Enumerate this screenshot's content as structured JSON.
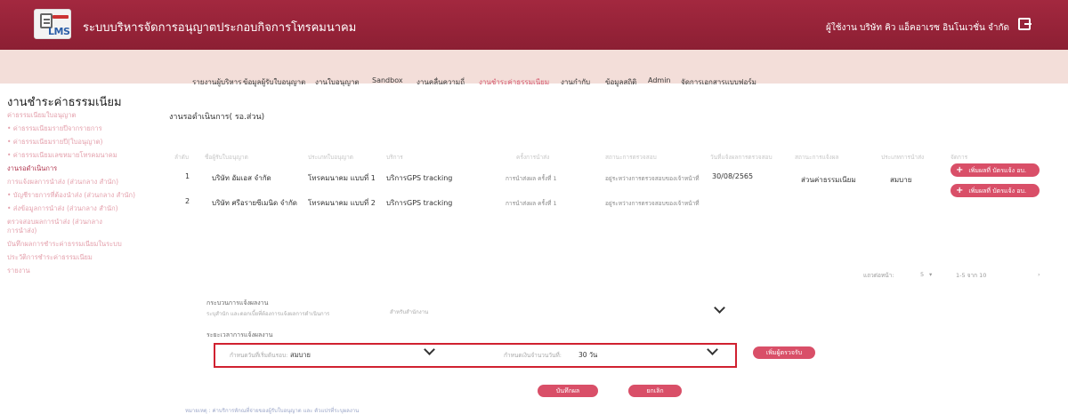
{
  "header": {
    "logo_text": "LMS",
    "title": "ระบบบริหารจัดการอนุญาตประกอบกิจการโทรคมนาคม",
    "user": "ผู้ใช้งาน บริษัท คิว แอ็คอาเรซ อินโนเวชั่น จำกัด"
  },
  "nav": {
    "items": [
      {
        "label": "รายงานผู้บริหาร"
      },
      {
        "label": "ข้อมูลผู้รับใบอนุญาต"
      },
      {
        "label": "งานใบอนุญาต"
      },
      {
        "label": "Sandbox"
      },
      {
        "label": "งานคลื่นความถี่"
      },
      {
        "label": "งานชำระค่าธรรมเนียม"
      },
      {
        "label": "งานกำกับ"
      },
      {
        "label": "ข้อมูลสถิติ"
      },
      {
        "label": "Admin"
      },
      {
        "label": "จัดการเอกสารแบบฟอร์ม"
      }
    ]
  },
  "sidebar": {
    "title": "งานชำระค่าธรรมเนียม",
    "items": [
      {
        "label": "ค่าธรรมเนียมใบอนุญาต"
      },
      {
        "label": "• ค่าธรรมเนียมรายปีจากรายการ"
      },
      {
        "label": "• ค่าธรรมเนียมรายปี(ใบอนุญาต)"
      },
      {
        "label": "• ค่าธรรมเนียมเลขหมายโทรคมนาคม"
      },
      {
        "label": "งานรอดำเนินการ"
      },
      {
        "label": "การแจ้งผลการนำส่ง (ส่วนกลาง สำนัก)"
      },
      {
        "label": "• บัญชีรายการที่ต้องนำส่ง (ส่วนกลาง สำนัก)"
      },
      {
        "label": "• ส่งข้อมูลการนำส่ง (ส่วนกลาง สำนัก)"
      },
      {
        "label": "ตรวจสอบผลการนำส่ง (ส่วนกลาง"
      },
      {
        "label": "การนำส่ง)"
      },
      {
        "label": "บันทึกผลการชำระค่าธรรมเนียมในระบบ"
      },
      {
        "label": "ประวัติการชำระค่าธรรมเนียม"
      },
      {
        "label": "รายงาน"
      }
    ]
  },
  "main": {
    "section_title": "งานรอดำเนินการ( รอ.ส่วน)",
    "table": {
      "headers": [
        "ลำดับ",
        "ชื่อผู้รับใบอนุญาต",
        "ประเภทใบอนุญาต",
        "บริการ",
        "ครั้งการนำส่ง",
        "สถานะการตรวจสอบ",
        "วันที่แจ้งผลการตรวจสอบ",
        "สถานะการแจ้งผล",
        "ประเภทการนำส่ง",
        "จัดการ"
      ],
      "rows": [
        {
          "no": "1",
          "name": "บริษัท อัมเอส จำกัด",
          "type": "โทรคมนาคม แบบที่ 1",
          "service": "บริการGPS tracking",
          "round": "การนำส่งผล ครั้งที่ 1",
          "status": "อยู่ระหว่างการตรวจสอบของเจ้าหน้าที่",
          "date": "30/08/2565",
          "notify": "ส่วนค่าธรรมเนียม",
          "send_type": "สมบาย",
          "action": "เพิ่มผลที่ บัตรแจ้ง อบ."
        },
        {
          "no": "2",
          "name": "บริษัท ศรีอรายซีเมนิด จำกัด",
          "type": "โทรคมนาคม แบบที่ 2",
          "service": "บริการGPS tracking",
          "round": "การนำส่งผล ครั้งที่ 1",
          "status": "อยู่ระหว่างการตรวจสอบของเจ้าหน้าที่",
          "date": "",
          "notify": "",
          "send_type": "",
          "action": "เพิ่มผลที่ บัตรแจ้ง อบ."
        }
      ]
    },
    "pagination": {
      "rows_label": "แถวต่อหน้า:",
      "rows_value": "5",
      "range": "1-5 จาก 10"
    },
    "form": {
      "section1_label": "กระบวนการแจ้งผลงาน",
      "section1_help": "ระบุสำนัก และดอกเบี้ยที่ต้องการแจ้งผลการดำเนินการ",
      "section1_field_label": "สำหรับสำนักงาน",
      "section2_label": "ระยะเวลาการแจ้งผลงาน",
      "field1_label": "กำหนดวันที่เริ่มต้นรอบ:",
      "field1_value": "สมบาย",
      "field2_label": "กำหนดเงินจำนวนวันที่:",
      "field2_value": "30 วัน",
      "add_button": "เพิ่มผู้ตรวจรับ",
      "save_button": "บันทึกผล",
      "cancel_button": "ยกเลิก"
    },
    "footer_note": "หมายเหตุ : ค่าบริการหักณที่จ่ายของผู้รับใบอนุญาต และ ตัวแปรที่ระบุผลงาน"
  }
}
